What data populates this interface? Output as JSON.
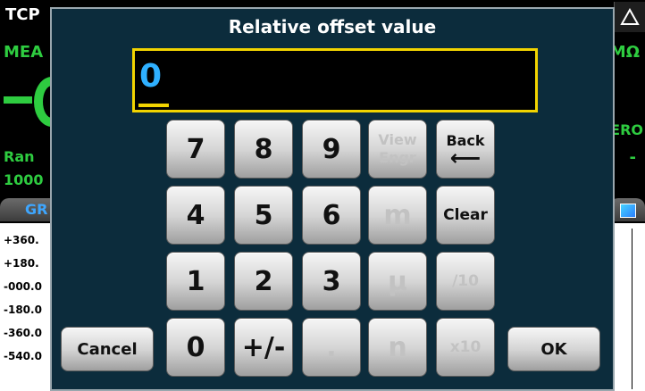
{
  "background": {
    "tab_left": "TCP",
    "measure_label": "MEA",
    "range_label": "Ran",
    "range_value": "1000",
    "units": "MΩ",
    "zero_label": "ERO",
    "dash2": "-",
    "graph_tab": "GR",
    "y_axis": [
      "+360.",
      "+180.",
      "-000.0",
      "-180.0",
      "-360.0",
      "-540.0"
    ]
  },
  "dialog": {
    "title": "Relative offset value",
    "value": "0"
  },
  "keypad": {
    "k7": "7",
    "k8": "8",
    "k9": "9",
    "view_line1": "View",
    "view_line2": "Engr",
    "back": "Back",
    "back_arrow": "⟵",
    "k4": "4",
    "k5": "5",
    "k6": "6",
    "m": "m",
    "clear": "Clear",
    "k1": "1",
    "k2": "2",
    "k3": "3",
    "mu": "µ",
    "div10": "/10",
    "k0": "0",
    "plusminus": "+/-",
    "dot": ".",
    "n": "n",
    "x10": "x10",
    "cancel": "Cancel",
    "ok": "OK"
  },
  "colors": {
    "dialog_bg": "#0c2c3c",
    "entry_border": "#f2d400",
    "entry_text": "#2fb0ff",
    "background_green": "#2ecc40"
  }
}
